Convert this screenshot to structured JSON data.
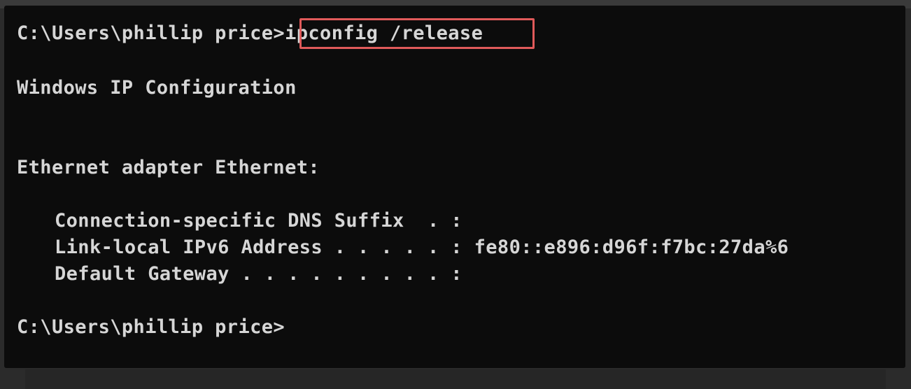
{
  "terminal": {
    "prompt_1": "C:\\Users\\phillip price>",
    "command": "ipconfig /release",
    "header": "Windows IP Configuration",
    "adapter": "Ethernet adapter Ethernet:",
    "rows": [
      {
        "label": "Connection-specific DNS Suffix  . :",
        "value": ""
      },
      {
        "label": "Link-local IPv6 Address . . . . . :",
        "value": " fe80::e896:d96f:f7bc:27da%6"
      },
      {
        "label": "Default Gateway . . . . . . . . . :",
        "value": ""
      }
    ],
    "prompt_2": "C:\\Users\\phillip price>"
  },
  "colors": {
    "background": "#0c0c0c",
    "text": "#d6d6d6",
    "highlight_border": "#e05a5a"
  }
}
